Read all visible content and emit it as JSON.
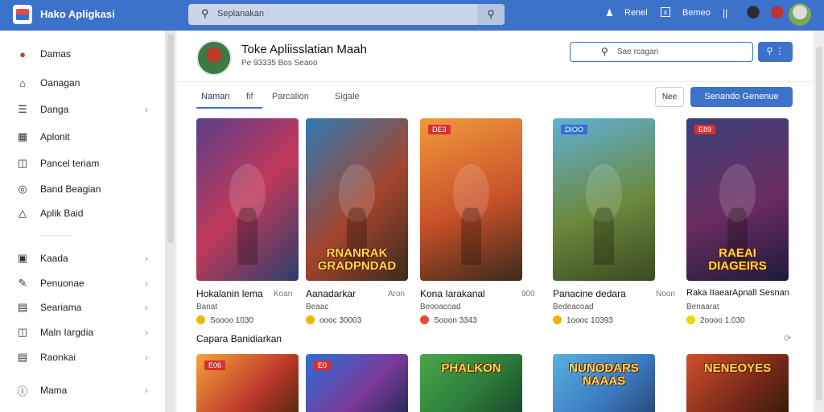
{
  "topbar": {
    "app_title": "Hako Apligkasi",
    "search_placeholder": "Seplanakan",
    "link1": "Renel",
    "link2": "Bemeo",
    "accent": "#3c72c9"
  },
  "sidebar": {
    "items": [
      {
        "label": "Damas",
        "icon": "app-logo-icon",
        "chevron": false
      },
      {
        "label": "Oanagan",
        "icon": "home-icon",
        "chevron": false
      },
      {
        "label": "Danga",
        "icon": "document-icon",
        "chevron": true
      },
      {
        "label": "Aplonit",
        "icon": "calendar-icon",
        "chevron": false
      },
      {
        "label": "Pancel teriam",
        "icon": "cart-icon",
        "chevron": false
      },
      {
        "label": "Band Beagian",
        "icon": "target-icon",
        "chevron": false
      },
      {
        "label": "Aplik Baid",
        "icon": "bell-icon",
        "chevron": false
      },
      {
        "label": "Kaada",
        "icon": "square-icon",
        "chevron": true
      },
      {
        "label": "Penuonae",
        "icon": "pen-icon",
        "chevron": true
      },
      {
        "label": "Seariama",
        "icon": "card-icon",
        "chevron": true
      },
      {
        "label": "Maln Iargdia",
        "icon": "image-icon",
        "chevron": true
      },
      {
        "label": "Raonkai",
        "icon": "list-icon",
        "chevron": true
      },
      {
        "label": "Mama",
        "icon": "info-icon",
        "chevron": true
      }
    ]
  },
  "store": {
    "title": "Toke Apliisslatian Maah",
    "subtitle": "Pe 93335 Bos Seaoo",
    "search_placeholder": "Sae rcagan",
    "tabs": [
      "Naman",
      "fif",
      "Parcalion",
      "Sigale"
    ],
    "btn_outline": "Nee",
    "btn_primary": "Senando Genenue"
  },
  "apps": [
    {
      "name": "Hokalanin lema",
      "right": "Koan",
      "dev": "Banat",
      "rating": "Soooo 1030",
      "badge": "",
      "banner": ""
    },
    {
      "name": "Aanadarkar",
      "right": "Aron",
      "dev": "Beaac",
      "rating": "oooc 30003",
      "badge": "",
      "banner": "RNANRAK GRADPNDAD"
    },
    {
      "name": "Kona Iarakanal",
      "right": "900",
      "dev": "Beooacoad",
      "rating": "Sooon 3343",
      "badge": "DE3",
      "banner": ""
    },
    {
      "name": "Panacine dedara",
      "right": "Noon",
      "dev": "Bedeacoad",
      "rating": "1oooc 10393",
      "badge": "DIOO",
      "banner": ""
    },
    {
      "name": "Raka IIaearApnall Sesnan",
      "right": "",
      "dev": "Benaarat",
      "rating": "2oooo 1.030",
      "badge": "E89",
      "banner": "RAEAI DIAGEIRS"
    }
  ],
  "section": {
    "title": "Capara Banidiarkan",
    "cards": [
      {
        "badge": "E06",
        "banner": ""
      },
      {
        "badge": "E0",
        "banner": ""
      },
      {
        "badge": "",
        "banner": "PHALKON"
      },
      {
        "badge": "",
        "banner": "NUNODARS NAAAS"
      },
      {
        "badge": "",
        "banner": "NENEOYES"
      }
    ]
  }
}
